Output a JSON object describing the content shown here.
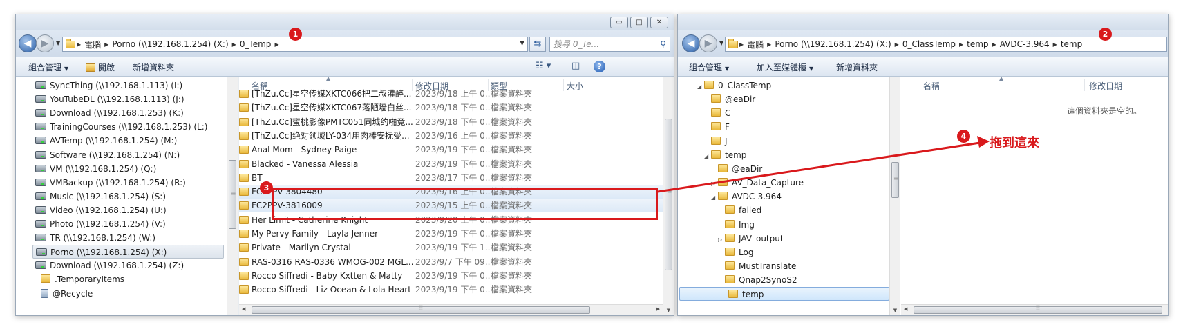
{
  "left": {
    "address": {
      "crumbs": [
        "電腦",
        "Porno (\\\\192.168.1.254) (X:)",
        "0_Temp"
      ],
      "search_placeholder": "搜尋 0_Te..."
    },
    "toolbar": {
      "organize": "組合管理",
      "open": "開啟",
      "new_folder": "新增資料夾"
    },
    "nav_items": [
      "SyncThing (\\\\192.168.1.113) (I:)",
      "YouTubeDL (\\\\192.168.1.113) (J:)",
      "Download (\\\\192.168.1.253) (K:)",
      "TrainingCourses (\\\\192.168.1.253) (L:)",
      "AVTemp (\\\\192.168.1.254) (M:)",
      "Software (\\\\192.168.1.254) (N:)",
      "VM (\\\\192.168.1.254) (Q:)",
      "VMBackup (\\\\192.168.1.254) (R:)",
      "Music (\\\\192.168.1.254) (S:)",
      "Video (\\\\192.168.1.254) (U:)",
      "Photo (\\\\192.168.1.254) (V:)",
      "TR (\\\\192.168.1.254) (W:)",
      "Porno (\\\\192.168.1.254) (X:)",
      "Download (\\\\192.168.1.254) (Z:)",
      ".TemporaryItems",
      "@Recycle"
    ],
    "columns": {
      "name": "名稱",
      "date": "修改日期",
      "type": "類型",
      "size": "大小"
    },
    "rows": [
      {
        "name": "[ThZu.Cc]星空传媒XKTC066把二叔灌醉...",
        "date": "2023/9/18 上午 0...",
        "type": "檔案資料夾"
      },
      {
        "name": "[ThZu.Cc]星空传媒XKTC067落陋墙白丝...",
        "date": "2023/9/18 下午 0...",
        "type": "檔案資料夾"
      },
      {
        "name": "[ThZu.Cc]蜜桃影像PMTC051同城约啪竟...",
        "date": "2023/9/18 下午 0...",
        "type": "檔案資料夾"
      },
      {
        "name": "[ThZu.Cc]绝对领域LY-034用肉棒安抚受...",
        "date": "2023/9/16 上午 0...",
        "type": "檔案資料夾"
      },
      {
        "name": "Anal Mom - Sydney Paige",
        "date": "2023/9/19 下午 0...",
        "type": "檔案資料夾"
      },
      {
        "name": "Blacked - Vanessa Alessia",
        "date": "2023/9/19 下午 0...",
        "type": "檔案資料夾"
      },
      {
        "name": "BT",
        "date": "2023/8/17 下午 0...",
        "type": "檔案資料夾"
      },
      {
        "name": "FC2PPV-3804480",
        "date": "2023/9/16 上午 0...",
        "type": "檔案資料夾"
      },
      {
        "name": "FC2PPV-3816009",
        "date": "2023/9/15 上午 0...",
        "type": "檔案資料夾"
      },
      {
        "name": "Her Limit - Catherine Knight",
        "date": "2023/9/20 上午 0...",
        "type": "檔案資料夾"
      },
      {
        "name": "My Pervy Family - Layla Jenner",
        "date": "2023/9/19 下午 0...",
        "type": "檔案資料夾"
      },
      {
        "name": "Private - Marilyn Crystal",
        "date": "2023/9/19 下午 1...",
        "type": "檔案資料夾"
      },
      {
        "name": "RAS-0316 RAS-0336 WMOG-002 MGL...",
        "date": "2023/9/7 下午 09...",
        "type": "檔案資料夾"
      },
      {
        "name": "Rocco Siffredi - Baby Kxtten & Matty",
        "date": "2023/9/19 下午 0...",
        "type": "檔案資料夾"
      },
      {
        "name": "Rocco Siffredi - Liz Ocean & Lola Heart",
        "date": "2023/9/19 下午 0...",
        "type": "檔案資料夾"
      }
    ]
  },
  "right": {
    "address": {
      "crumbs": [
        "電腦",
        "Porno (\\\\192.168.1.254) (X:)",
        "0_ClassTemp",
        "temp",
        "AVDC-3.964",
        "temp"
      ]
    },
    "toolbar": {
      "organize": "組合管理",
      "add_media": "加入至媒體櫃",
      "new_folder": "新增資料夾"
    },
    "tree": [
      {
        "label": "0_ClassTemp",
        "level": 0,
        "expand": "open"
      },
      {
        "label": "@eaDir",
        "level": 1,
        "expand": ""
      },
      {
        "label": "C",
        "level": 1,
        "expand": ""
      },
      {
        "label": "F",
        "level": 1,
        "expand": ""
      },
      {
        "label": "J",
        "level": 1,
        "expand": ""
      },
      {
        "label": "temp",
        "level": 1,
        "expand": "open"
      },
      {
        "label": "@eaDir",
        "level": 2,
        "expand": ""
      },
      {
        "label": "AV_Data_Capture",
        "level": 2,
        "expand": "closed"
      },
      {
        "label": "AVDC-3.964",
        "level": 2,
        "expand": "open"
      },
      {
        "label": "failed",
        "level": 3,
        "expand": ""
      },
      {
        "label": "Img",
        "level": 3,
        "expand": ""
      },
      {
        "label": "JAV_output",
        "level": 3,
        "expand": "closed"
      },
      {
        "label": "Log",
        "level": 3,
        "expand": ""
      },
      {
        "label": "MustTranslate",
        "level": 3,
        "expand": ""
      },
      {
        "label": "Qnap2SynoS2",
        "level": 3,
        "expand": ""
      },
      {
        "label": "temp",
        "level": 3,
        "expand": ""
      }
    ],
    "columns": {
      "name": "名稱",
      "date": "修改日期"
    },
    "empty_message": "這個資料夾是空的。"
  },
  "annotations": {
    "b1": "1",
    "b2": "2",
    "b3": "3",
    "b4": "4",
    "drag_text": "拖到這來"
  },
  "colors": {
    "annotation_red": "#d9191c",
    "selection_blue": "#cfe6fb"
  }
}
